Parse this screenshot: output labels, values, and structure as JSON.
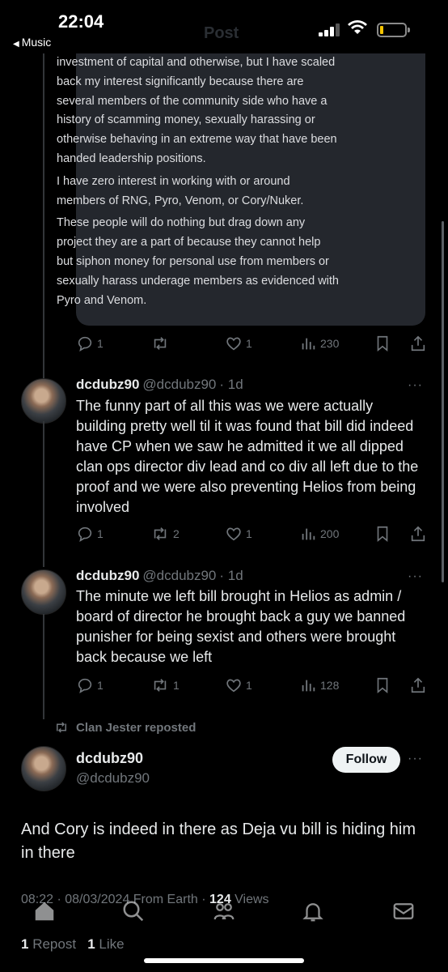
{
  "status_bar": {
    "time": "22:04",
    "back_label": "Music",
    "back_arrow": "◀",
    "header_title": "Post"
  },
  "embedded_image": {
    "paragraphs": [
      "investment of capital and otherwise, but I have scaled back my interest significantly because there are several members of the community side who have a history of scamming money, sexually harassing or otherwise behaving in an extreme way that have been handed leadership positions.",
      "I have zero interest in working with or around members of RNG, Pyro, Venom, or Cory/Nuker.",
      "These people will do nothing but drag down any project they are a part of because they cannot help but siphon money for personal use from members or sexually harass underage members as evidenced with Pyro and Venom."
    ]
  },
  "post1_actions": {
    "replies": "1",
    "reposts": "",
    "likes": "1",
    "views": "230"
  },
  "post2": {
    "name": "dcdubz90",
    "handle": "@dcdubz90",
    "time": "· 1d",
    "text": "The funny part of all this was we were actually building pretty well til it was found that bill did indeed have CP when we saw he admitted it we all dipped clan ops director div lead and co div all left due to the proof and we were also preventing Helios from being involved",
    "actions": {
      "replies": "1",
      "reposts": "2",
      "likes": "1",
      "views": "200"
    }
  },
  "post3": {
    "name": "dcdubz90",
    "handle": "@dcdubz90",
    "time": "· 1d",
    "text": "The minute we left bill brought in Helios as admin / board of director he brought back a guy we banned punisher for being sexist and others were brought back because we left",
    "actions": {
      "replies": "1",
      "reposts": "1",
      "likes": "1",
      "views": "128"
    }
  },
  "reposted_by": "Clan Jester reposted",
  "main_post": {
    "name": "dcdubz90",
    "handle": "@dcdubz90",
    "follow_label": "Follow",
    "text": "And Cory is indeed in there as Deja vu bill is hiding him in there",
    "meta_prefix": "08:22 · 08/03/2024 From Earth · ",
    "views_count": "124",
    "views_label": " Views",
    "repost_count": "1",
    "repost_label": " Repost",
    "like_count": "1",
    "like_label": " Like"
  },
  "more_glyph": "···",
  "colors": {
    "background": "#000000",
    "muted": "#71767b",
    "text": "#e7e9ea",
    "card": "#24272d"
  },
  "icons": [
    "signal-icon",
    "wifi-icon",
    "battery-icon",
    "reply-icon",
    "repost-icon",
    "like-icon",
    "views-icon",
    "bookmark-icon",
    "share-icon",
    "home-icon",
    "search-icon",
    "communities-icon",
    "notifications-icon",
    "messages-icon"
  ]
}
